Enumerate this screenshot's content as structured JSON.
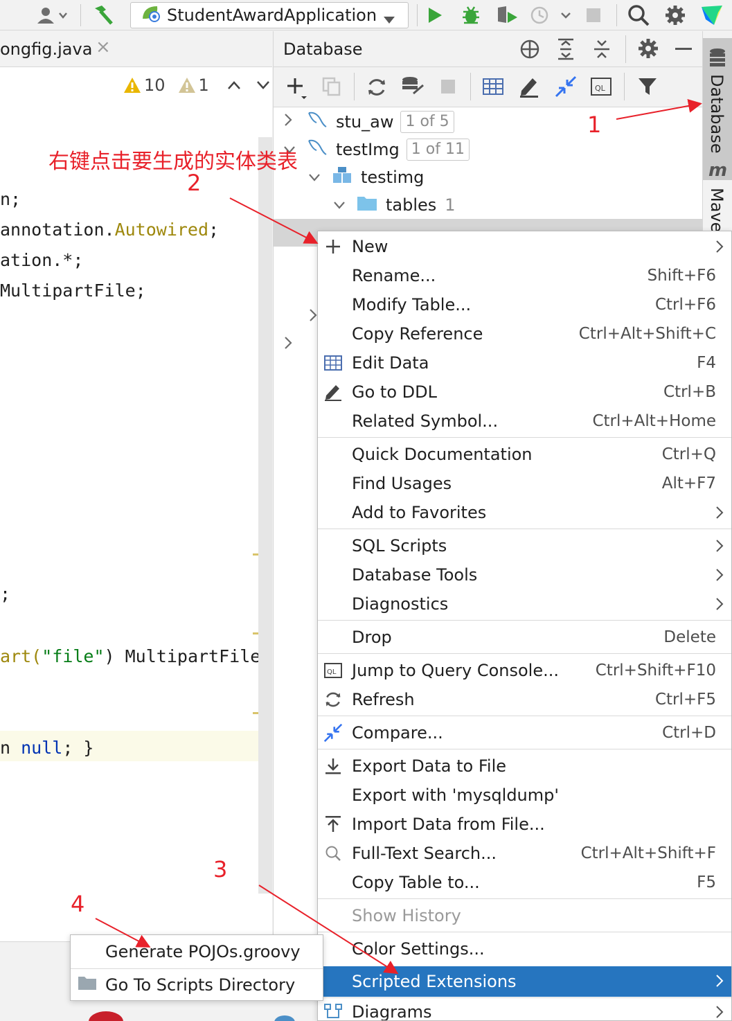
{
  "toolbar": {
    "run_config_label": "StudentAwardApplication",
    "icons": [
      "user-icon",
      "build-hammer-icon",
      "run-icon",
      "debug-icon",
      "coverage-icon",
      "profile-icon",
      "stop-icon",
      "search-icon",
      "settings-icon",
      "toolbox-icon"
    ]
  },
  "editor": {
    "tab_label": "ongfig.java",
    "inspections": {
      "warnings": "10",
      "weak_warnings": "1"
    },
    "lines": {
      "l1": "n;",
      "l2a": "annotation.",
      "l2b": "Autowired",
      "l2c": ";",
      "l3": "ation.*;",
      "l4": "MultipartFile;",
      "l5": ";",
      "l6a": "art(",
      "l6b": "\"file\"",
      "l6c": ") MultipartFile",
      "l7a": "n ",
      "l7b": "null",
      "l7c": "; }"
    }
  },
  "annotations": {
    "instruction": "右键点击要生成的实体类表",
    "step1": "1",
    "step2": "2",
    "step3": "3",
    "step4": "4"
  },
  "database_panel": {
    "title": "Database",
    "tree": [
      {
        "label": "stu_aw",
        "badge": "1 of 5"
      },
      {
        "label": "testImg",
        "badge": "1 of 11"
      },
      {
        "label": "testimg",
        "badge": ""
      },
      {
        "label": "tables",
        "count": "1"
      }
    ]
  },
  "right_sidebar": {
    "database_tab": "Database",
    "maven_tab": "Mave",
    "maven_glyph": "m"
  },
  "context_menu": {
    "items": [
      {
        "label": "New",
        "shortcut": "",
        "submenu": true
      },
      {
        "label": "Rename...",
        "shortcut": "Shift+F6"
      },
      {
        "label": "Modify Table...",
        "shortcut": "Ctrl+F6"
      },
      {
        "label": "Copy Reference",
        "shortcut": "Ctrl+Alt+Shift+C"
      },
      {
        "label": "Edit Data",
        "shortcut": "F4"
      },
      {
        "label": "Go to DDL",
        "shortcut": "Ctrl+B"
      },
      {
        "label": "Related Symbol...",
        "shortcut": "Ctrl+Alt+Home"
      },
      {
        "label": "Quick Documentation",
        "shortcut": "Ctrl+Q"
      },
      {
        "label": "Find Usages",
        "shortcut": "Alt+F7"
      },
      {
        "label": "Add to Favorites",
        "shortcut": "",
        "submenu": true
      },
      {
        "label": "SQL Scripts",
        "shortcut": "",
        "submenu": true
      },
      {
        "label": "Database Tools",
        "shortcut": "",
        "submenu": true
      },
      {
        "label": "Diagnostics",
        "shortcut": "",
        "submenu": true
      },
      {
        "label": "Drop",
        "shortcut": "Delete"
      },
      {
        "label": "Jump to Query Console...",
        "shortcut": "Ctrl+Shift+F10"
      },
      {
        "label": "Refresh",
        "shortcut": "Ctrl+F5"
      },
      {
        "label": "Compare...",
        "shortcut": "Ctrl+D"
      },
      {
        "label": "Export Data to File",
        "shortcut": ""
      },
      {
        "label": "Export with 'mysqldump'",
        "shortcut": ""
      },
      {
        "label": "Import Data from File...",
        "shortcut": ""
      },
      {
        "label": "Full-Text Search...",
        "shortcut": "Ctrl+Alt+Shift+F"
      },
      {
        "label": "Copy Table to...",
        "shortcut": "F5"
      },
      {
        "label": "Show History",
        "shortcut": "",
        "disabled": true
      },
      {
        "label": "Color Settings...",
        "shortcut": ""
      },
      {
        "label": "Scripted Extensions",
        "shortcut": "",
        "submenu": true,
        "selected": true
      },
      {
        "label": "Diagrams",
        "shortcut": "",
        "submenu": true
      }
    ]
  },
  "submenu": {
    "items": [
      {
        "label": "Generate POJOs.groovy"
      },
      {
        "label": "Go To Scripts Directory"
      }
    ]
  },
  "colors": {
    "selection": "#2675bf",
    "annotation_red": "#e8212a",
    "run_green": "#3aa53a"
  }
}
